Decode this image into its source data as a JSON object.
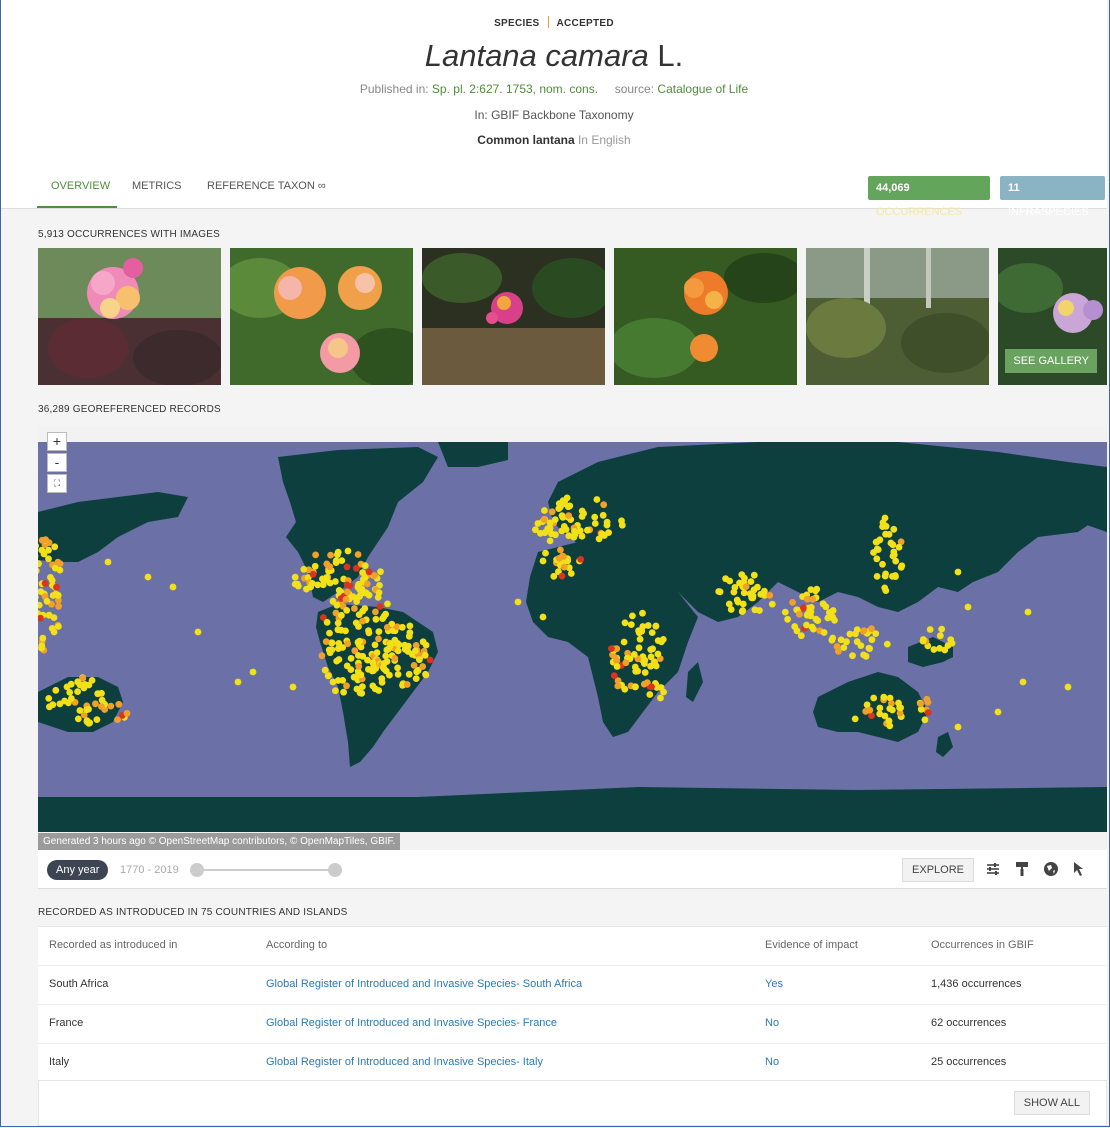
{
  "header": {
    "rank": "SPECIES",
    "status": "ACCEPTED",
    "title_italic": "Lantana camara",
    "title_author": " L.",
    "published_label": "Published in:",
    "published_value": "Sp. pl. 2:627. 1753, nom. cons.",
    "source_label": "source:",
    "source_value": "Catalogue of Life",
    "in_line": "In: GBIF Backbone Taxonomy",
    "common_name": "Common lantana",
    "common_lang": " In English"
  },
  "tabs": [
    "OVERVIEW",
    "METRICS",
    "REFERENCE TAXON ∞"
  ],
  "badges": {
    "occurrences_count": "44,069",
    "occurrences_label": " OCCURRENCES",
    "infraspecies_count": "11",
    "infraspecies_label": " INFRASPECIES"
  },
  "images": {
    "label": "5,913 OCCURRENCES WITH IMAGES",
    "gallery_button": "SEE GALLERY"
  },
  "map": {
    "label": "36,289 GEOREFERENCED RECORDS",
    "zoom_in": "+",
    "zoom_out": "-",
    "credits": "Generated 3 hours ago © OpenStreetMap contributors, © OpenMapTiles, GBIF.",
    "colors": {
      "ocean": "#6b70a6",
      "land": "#0c3f3d",
      "low": "#f2e018",
      "mid": "#f0a12a",
      "high": "#d9341e"
    }
  },
  "controls": {
    "any_year": "Any year",
    "year_range": "1770 - 2019",
    "explore": "EXPLORE"
  },
  "introduced": {
    "label": "RECORDED AS INTRODUCED IN 75 COUNTRIES AND ISLANDS",
    "headers": [
      "Recorded as introduced in",
      "According to",
      "Evidence of impact",
      "Occurrences in GBIF"
    ],
    "rows": [
      {
        "country": "South Africa",
        "source": "Global Register of Introduced and Invasive Species- South Africa",
        "impact": "Yes",
        "occurrences": "1,436 occurrences"
      },
      {
        "country": "France",
        "source": "Global Register of Introduced and Invasive Species- France",
        "impact": "No",
        "occurrences": "62 occurrences"
      },
      {
        "country": "Italy",
        "source": "Global Register of Introduced and Invasive Species- Italy",
        "impact": "No",
        "occurrences": "25 occurrences"
      }
    ],
    "show_all": "SHOW ALL"
  }
}
